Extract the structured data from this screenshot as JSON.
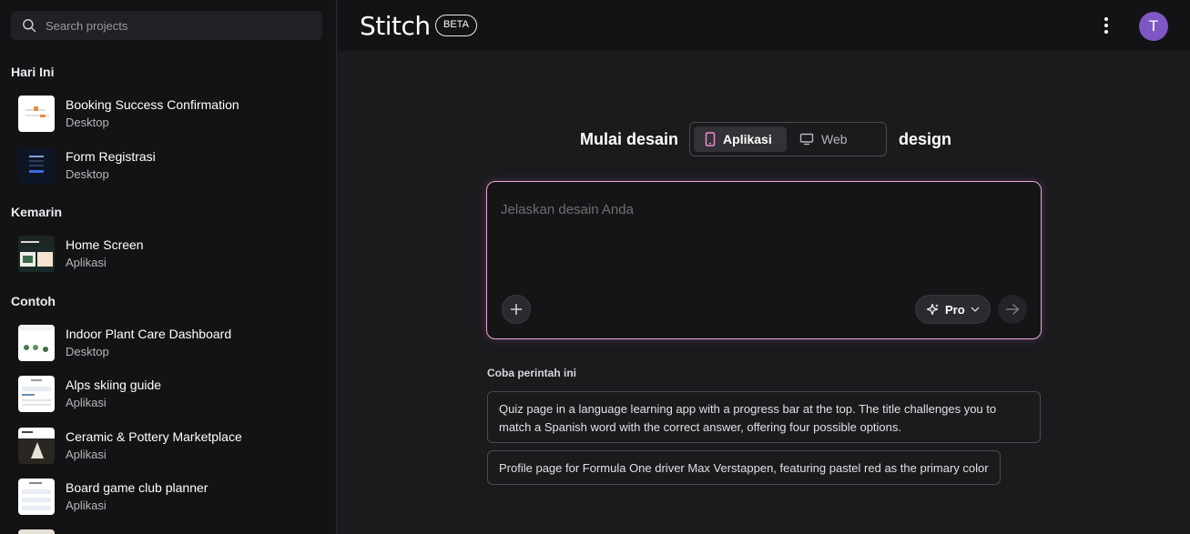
{
  "sidebar": {
    "search_placeholder": "Search projects",
    "sections": [
      {
        "label": "Hari Ini",
        "items": [
          {
            "name": "Booking Success Confirmation",
            "type": "Desktop"
          },
          {
            "name": "Form Registrasi",
            "type": "Desktop"
          }
        ]
      },
      {
        "label": "Kemarin",
        "items": [
          {
            "name": "Home Screen",
            "type": "Aplikasi"
          }
        ]
      },
      {
        "label": "Contoh",
        "items": [
          {
            "name": "Indoor Plant Care Dashboard",
            "type": "Desktop"
          },
          {
            "name": "Alps skiing guide",
            "type": "Aplikasi"
          },
          {
            "name": "Ceramic & Pottery Marketplace",
            "type": "Aplikasi"
          },
          {
            "name": "Board game club planner",
            "type": "Aplikasi"
          }
        ]
      }
    ]
  },
  "header": {
    "logo": "Stitch",
    "badge": "BETA",
    "avatar_initial": "T",
    "avatar_color": "#7e57c2"
  },
  "main": {
    "lead": "Mulai desain",
    "trail": "design",
    "modes": [
      {
        "label": "Aplikasi",
        "icon": "phone-icon",
        "active": true
      },
      {
        "label": "Web",
        "icon": "monitor-icon",
        "active": false
      }
    ],
    "prompt_placeholder": "Jelaskan desain Anda",
    "model_label": "Pro",
    "suggest_label": "Coba perintah ini",
    "suggestions": [
      "Quiz page in a language learning app with a progress bar at the top. The title challenges you to match a Spanish word with the correct answer, offering four possible options.",
      "Profile page for Formula One driver Max Verstappen, featuring pastel red as the primary color"
    ]
  },
  "colors": {
    "accent_border": "#e7a7d9",
    "background": "#1b1a1d",
    "sidebar": "#131315"
  }
}
